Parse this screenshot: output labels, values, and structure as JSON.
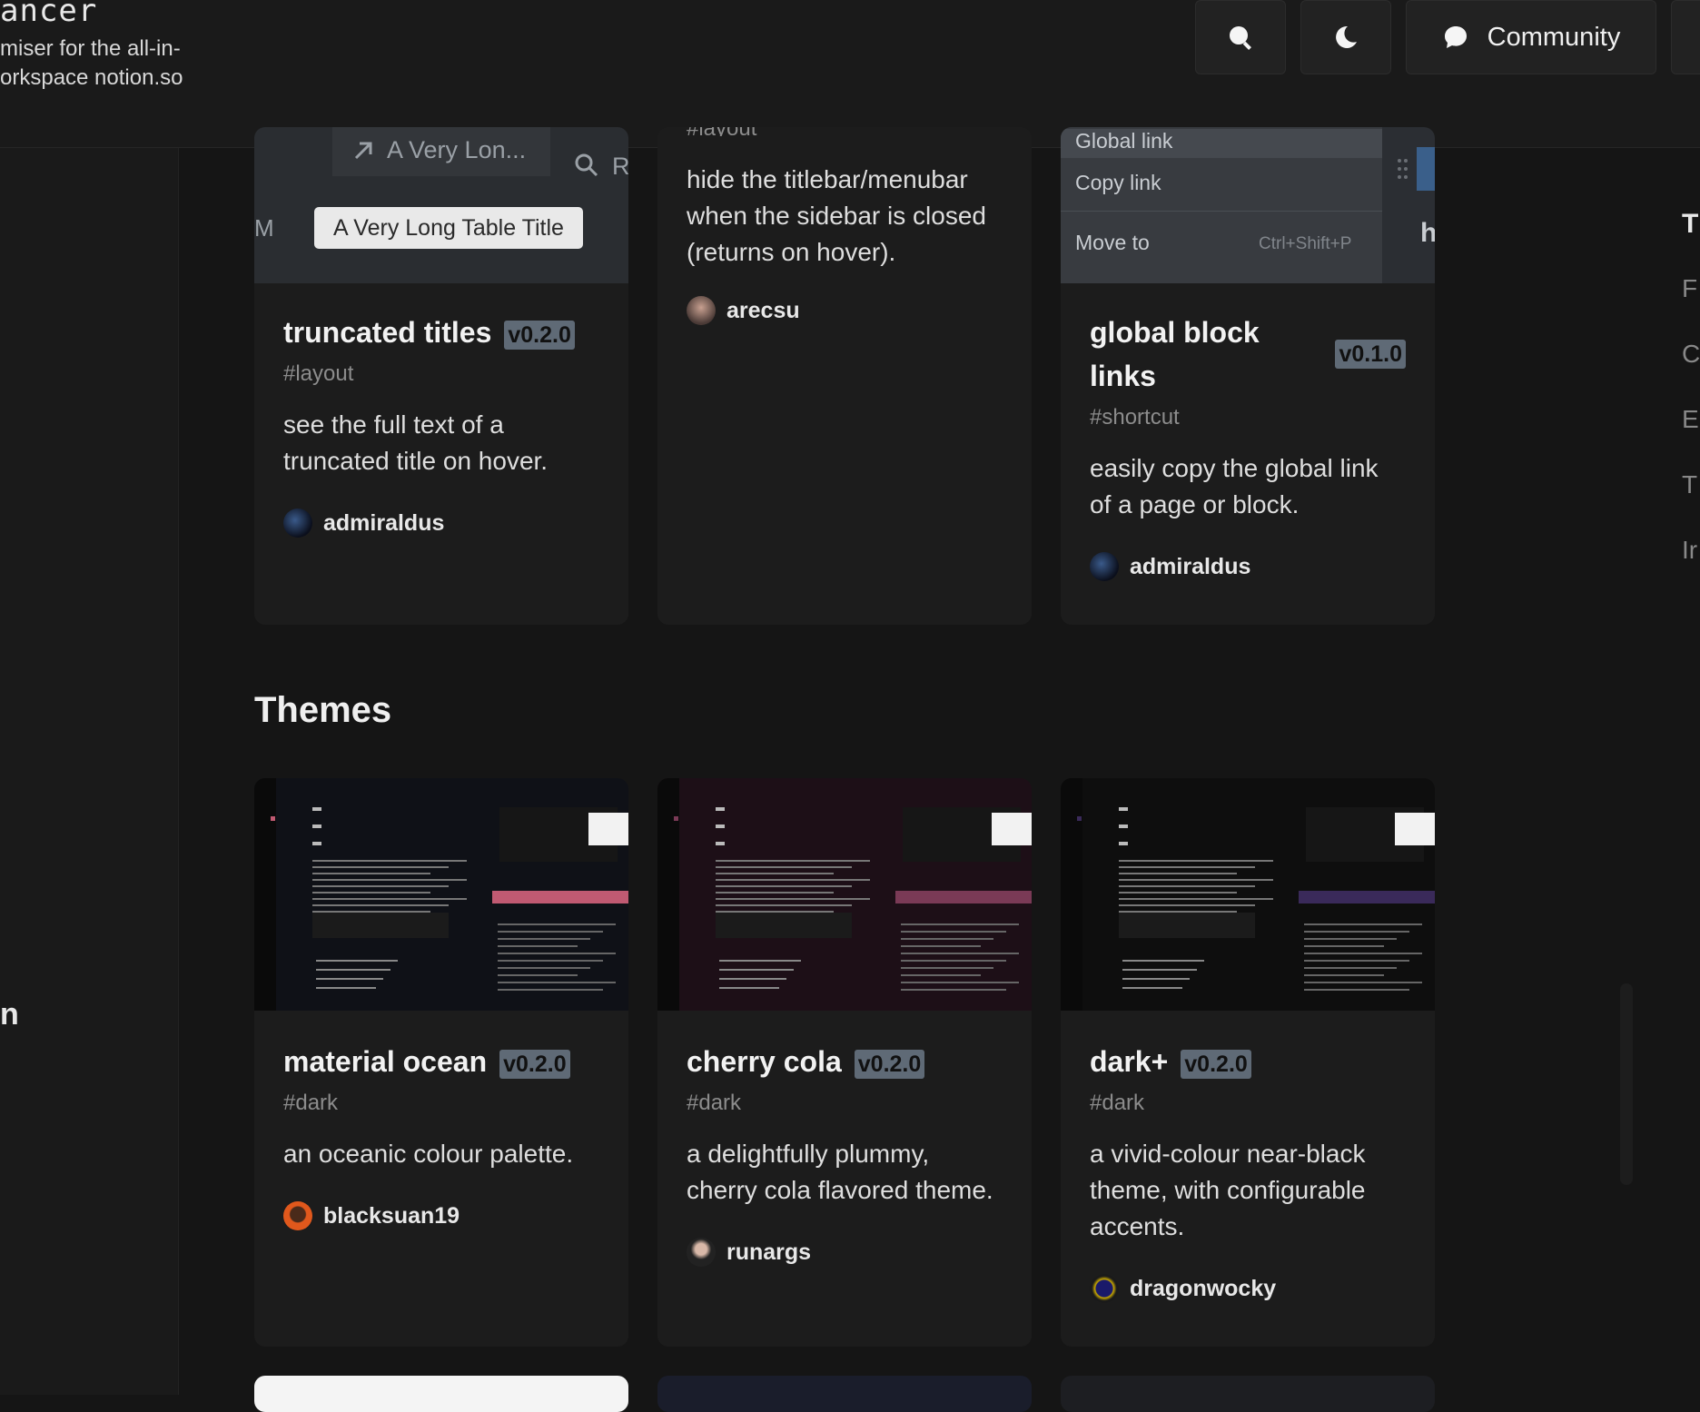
{
  "header": {
    "brand_title": "ancer",
    "brand_tagline": "miser for the all-in-\norkspace notion.so",
    "community_label": "Community",
    "search_icon": "search-icon",
    "theme_icon": "moon-icon",
    "community_icon": "chat-bubble-icon"
  },
  "left_sidebar": {
    "partial_letter": "n"
  },
  "right_toc": {
    "items": [
      "T",
      "F",
      "C",
      "E",
      "T",
      "Ir"
    ]
  },
  "extensions": [
    {
      "title": "truncated titles",
      "version": "v0.2.0",
      "tag": "#layout",
      "description": "see the full text of a truncated title on hover.",
      "author": "admiraldus",
      "preview": {
        "tab_text": "A Very Lon...",
        "tooltip_text": "A Very Long Table Title",
        "side_letter": "M",
        "search_letter": "R"
      }
    },
    {
      "title": "",
      "version": "",
      "tag": "#layout",
      "description": "hide the titlebar/menubar when the sidebar is closed (returns on hover).",
      "author": "arecsu"
    },
    {
      "title": "global block links",
      "version": "v0.1.0",
      "tag": "#shortcut",
      "description": "easily copy the global link of a page or block.",
      "author": "admiraldus",
      "preview": {
        "menu_item_1": "Global link",
        "menu_item_2": "Copy link",
        "menu_item_3": "Move to",
        "shortcut": "Ctrl+Shift+P",
        "side_letter": "h"
      }
    }
  ],
  "themes_section": {
    "title": "Themes"
  },
  "themes": [
    {
      "title": "material ocean",
      "version": "v0.2.0",
      "tag": "#dark",
      "description": "an oceanic colour palette.",
      "author": "blacksuan19",
      "bg": "#0f1117",
      "accent": "#c05a72"
    },
    {
      "title": "cherry cola",
      "version": "v0.2.0",
      "tag": "#dark",
      "description": "a delightfully plummy, cherry cola flavored theme.",
      "author": "runargs",
      "bg": "#1d0f17",
      "accent": "#7a3a56"
    },
    {
      "title": "dark+",
      "version": "v0.2.0",
      "tag": "#dark",
      "description": "a vivid-colour near-black theme, with configurable accents.",
      "author": "dragonwocky",
      "bg": "#0e0e0e",
      "accent": "#3a2a5a"
    }
  ],
  "colors": {
    "background": "#151515",
    "card": "#1c1c1c",
    "badge": "#5f6a76",
    "tag": "#8c8c8c"
  }
}
